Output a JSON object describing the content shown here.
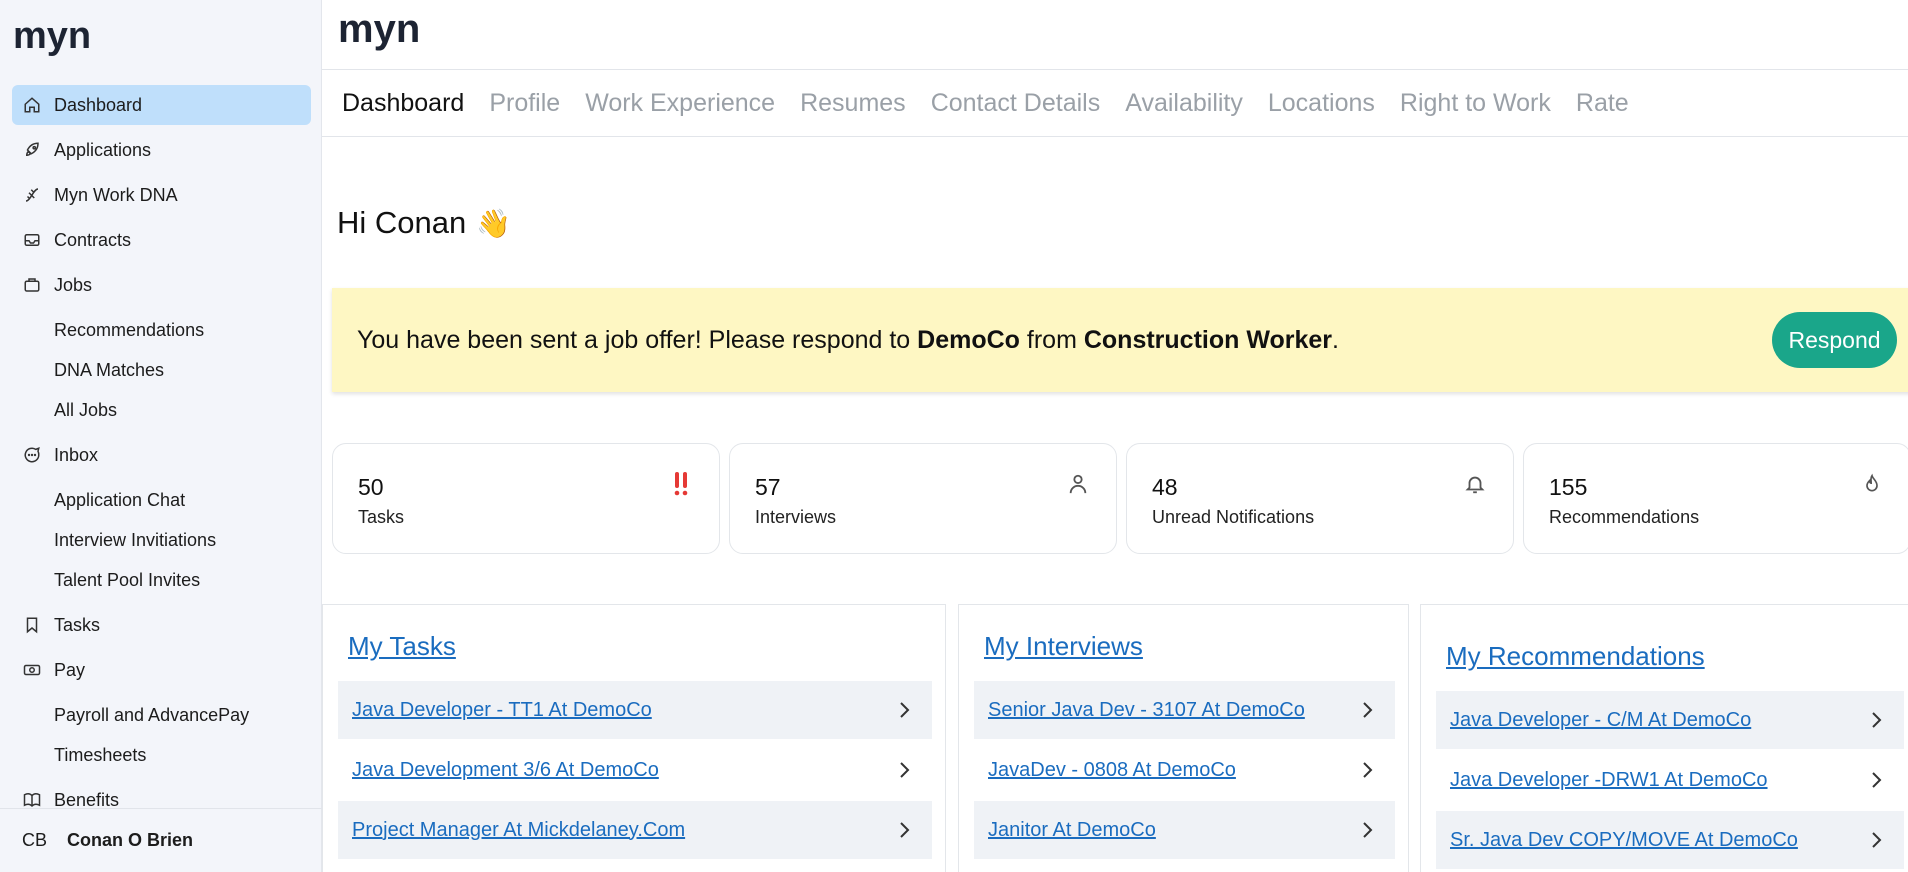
{
  "brand": {
    "logo_text": "myn"
  },
  "sidebar": {
    "items": [
      {
        "label": "Dashboard",
        "icon": "home-icon",
        "active": true
      },
      {
        "label": "Applications",
        "icon": "rocket-icon"
      },
      {
        "label": "Myn Work DNA",
        "icon": "dna-icon"
      },
      {
        "label": "Contracts",
        "icon": "inbox-tray-icon"
      },
      {
        "label": "Jobs",
        "icon": "briefcase-icon",
        "children": [
          "Recommendations",
          "DNA Matches",
          "All Jobs"
        ]
      },
      {
        "label": "Inbox",
        "icon": "chat-bubble-icon",
        "children": [
          "Application Chat",
          "Interview Invitiations",
          "Talent Pool Invites"
        ]
      },
      {
        "label": "Tasks",
        "icon": "bookmark-icon"
      },
      {
        "label": "Pay",
        "icon": "banknote-icon",
        "children": [
          "Payroll and AdvancePay",
          "Timesheets"
        ]
      },
      {
        "label": "Benefits",
        "icon": "book-icon"
      }
    ],
    "user": {
      "initials": "CB",
      "name": "Conan O Brien"
    }
  },
  "tabs": [
    {
      "label": "Dashboard",
      "active": true
    },
    {
      "label": "Profile"
    },
    {
      "label": "Work Experience"
    },
    {
      "label": "Resumes"
    },
    {
      "label": "Contact Details"
    },
    {
      "label": "Availability"
    },
    {
      "label": "Locations"
    },
    {
      "label": "Right to Work"
    },
    {
      "label": "Rate"
    }
  ],
  "greeting": {
    "text": "Hi Conan",
    "emoji": "👋"
  },
  "offer": {
    "prefix": "You have been sent a job offer! Please respond to ",
    "company": "DemoCo",
    "middle": " from ",
    "role": "Construction Worker",
    "suffix": ".",
    "button_label": "Respond",
    "accent": "#1aa68a",
    "background": "#fef7c3"
  },
  "stats": [
    {
      "value": "50",
      "label": "Tasks",
      "icon": "double-exclamation-icon",
      "icon_color": "#e53935"
    },
    {
      "value": "57",
      "label": "Interviews",
      "icon": "person-icon"
    },
    {
      "value": "48",
      "label": "Unread Notifications",
      "icon": "bell-icon"
    },
    {
      "value": "155",
      "label": "Recommendations",
      "icon": "flame-icon"
    }
  ],
  "panels": {
    "tasks": {
      "title": "My Tasks",
      "rows": [
        "Java Developer - TT1 At DemoCo",
        "Java Development 3/6 At DemoCo",
        "Project Manager At Mickdelaney.Com"
      ]
    },
    "interviews": {
      "title": "My Interviews",
      "rows": [
        "Senior Java Dev - 3107 At DemoCo",
        "JavaDev - 0808 At DemoCo",
        "Janitor At DemoCo"
      ]
    },
    "recommendations": {
      "title": "My Recommendations",
      "rows": [
        "Java Developer - C/M At DemoCo",
        "Java Developer -DRW1 At DemoCo",
        "Sr. Java Dev COPY/MOVE At DemoCo"
      ]
    }
  },
  "colors": {
    "link": "#1a6cbf",
    "active_nav": "#bfdffb",
    "sidebar_bg": "#f3f5fa"
  }
}
